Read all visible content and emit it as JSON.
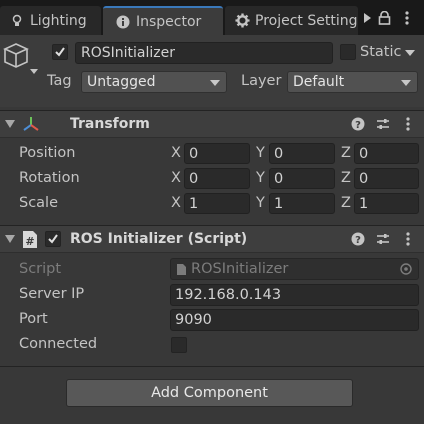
{
  "tabs": [
    {
      "label": "Lighting",
      "icon": "lighting-icon"
    },
    {
      "label": "Inspector",
      "icon": "info-icon"
    },
    {
      "label": "Project Settings",
      "icon": "gear-icon"
    }
  ],
  "tabbar_buttons": [
    "more-tabs-icon",
    "lock-icon",
    "kebab-menu-icon"
  ],
  "gameobject": {
    "active": true,
    "name": "ROSInitializer",
    "static_label": "Static",
    "static_checked": false,
    "tag_label": "Tag",
    "tag_value": "Untagged",
    "layer_label": "Layer",
    "layer_value": "Default"
  },
  "transform": {
    "title": "Transform",
    "rows": [
      {
        "label": "Position",
        "x": "0",
        "y": "0",
        "z": "0"
      },
      {
        "label": "Rotation",
        "x": "0",
        "y": "0",
        "z": "0"
      },
      {
        "label": "Scale",
        "x": "1",
        "y": "1",
        "z": "1"
      }
    ],
    "axes": [
      "X",
      "Y",
      "Z"
    ]
  },
  "script_component": {
    "title": "ROS Initializer (Script)",
    "enabled": true,
    "script_label": "Script",
    "script_value": "ROSInitializer",
    "server_ip_label": "Server IP",
    "server_ip_value": "192.168.0.143",
    "port_label": "Port",
    "port_value": "9090",
    "connected_label": "Connected",
    "connected_checked": false
  },
  "add_component_label": "Add Component",
  "colors": {
    "tab_accent": "#3a79bb",
    "panel_bg": "#383838",
    "field_bg": "#2a2a2a",
    "button_bg": "#585858"
  }
}
